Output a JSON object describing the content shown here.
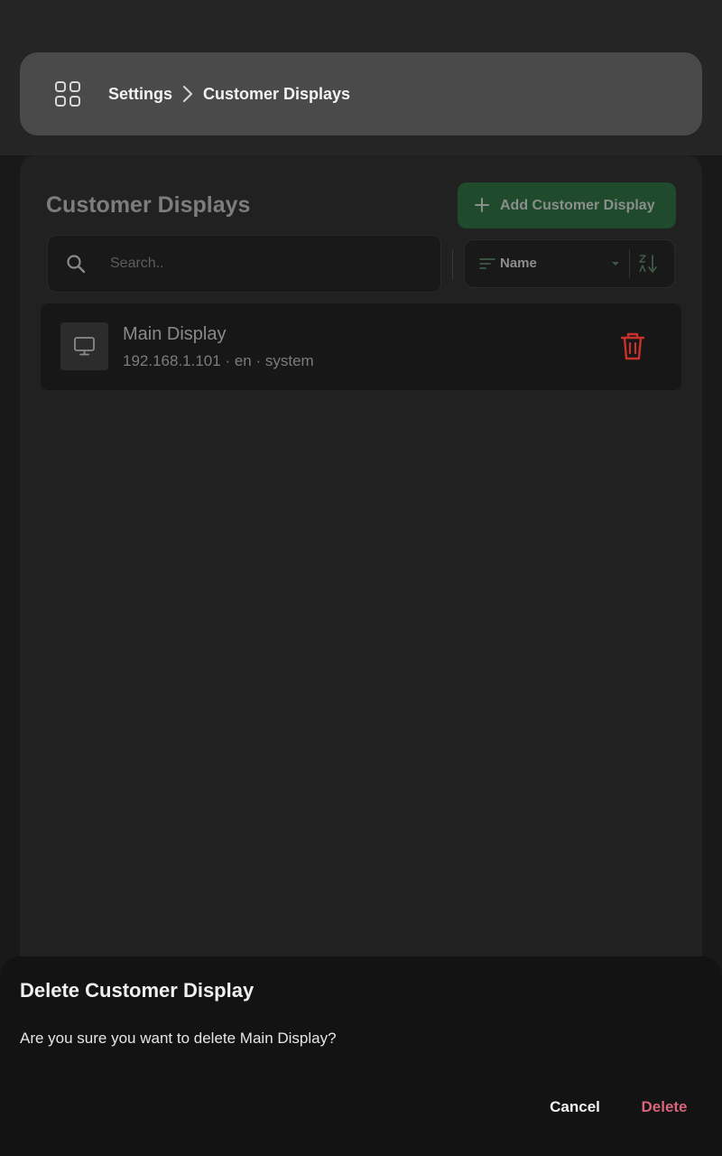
{
  "breadcrumb": {
    "root_label": "Settings",
    "current_label": "Customer Displays",
    "icons": {
      "apps": "apps-grid-icon",
      "separator": "chevron-right-icon"
    }
  },
  "main": {
    "title": "Customer Displays",
    "add_button": {
      "label": "Add Customer Display",
      "icon": "plus-icon"
    },
    "search": {
      "placeholder": "Search..",
      "value": "",
      "icon": "search-icon"
    },
    "sort": {
      "selected": "Name",
      "icons": {
        "sort": "sort-lines-icon",
        "dropdown": "dropdown-arrow-icon",
        "direction": "sort-az-icon"
      }
    },
    "items": [
      {
        "title": "Main Display",
        "subtitle": "192.168.1.101 · en · system",
        "icon": "monitor-icon",
        "action_icon": "trash-icon"
      }
    ]
  },
  "dialog": {
    "title": "Delete Customer Display",
    "message": "Are you sure you want to delete Main Display?",
    "cancel_label": "Cancel",
    "delete_label": "Delete"
  },
  "colors": {
    "background": "#191919",
    "panel": "#212121",
    "breadcrumb_card": "#4a4a4a",
    "add_button": "#1f4a2c",
    "delete_text": "#d9657a",
    "trash_icon": "#c8322b"
  }
}
